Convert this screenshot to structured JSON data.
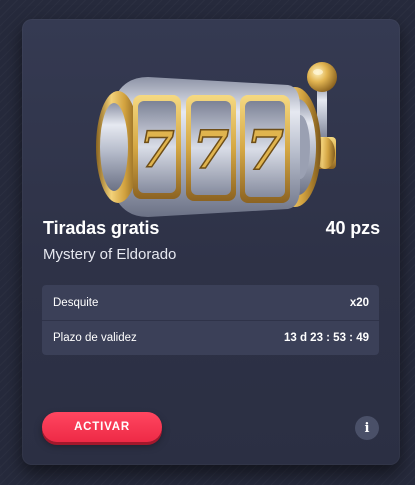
{
  "offer": {
    "title": "Tiradas gratis",
    "amount": "40 pzs",
    "game_name": "Mystery of Eldorado"
  },
  "slot_image": {
    "icon": "slot-machine-777",
    "reel_symbols": [
      "7",
      "7",
      "7"
    ],
    "colors": {
      "gold": "#d9ad45",
      "silver": "#c8ccd6"
    }
  },
  "details": [
    {
      "label": "Desquite",
      "value": "x20"
    },
    {
      "label": "Plazo de validez",
      "value": "13 d 23 : 53 : 49"
    }
  ],
  "actions": {
    "activate_label": "ACTIVAR",
    "info_label": "i"
  },
  "colors": {
    "accent": "#f2334f",
    "card_bg": "#30354b",
    "page_bg": "#262a3c"
  }
}
